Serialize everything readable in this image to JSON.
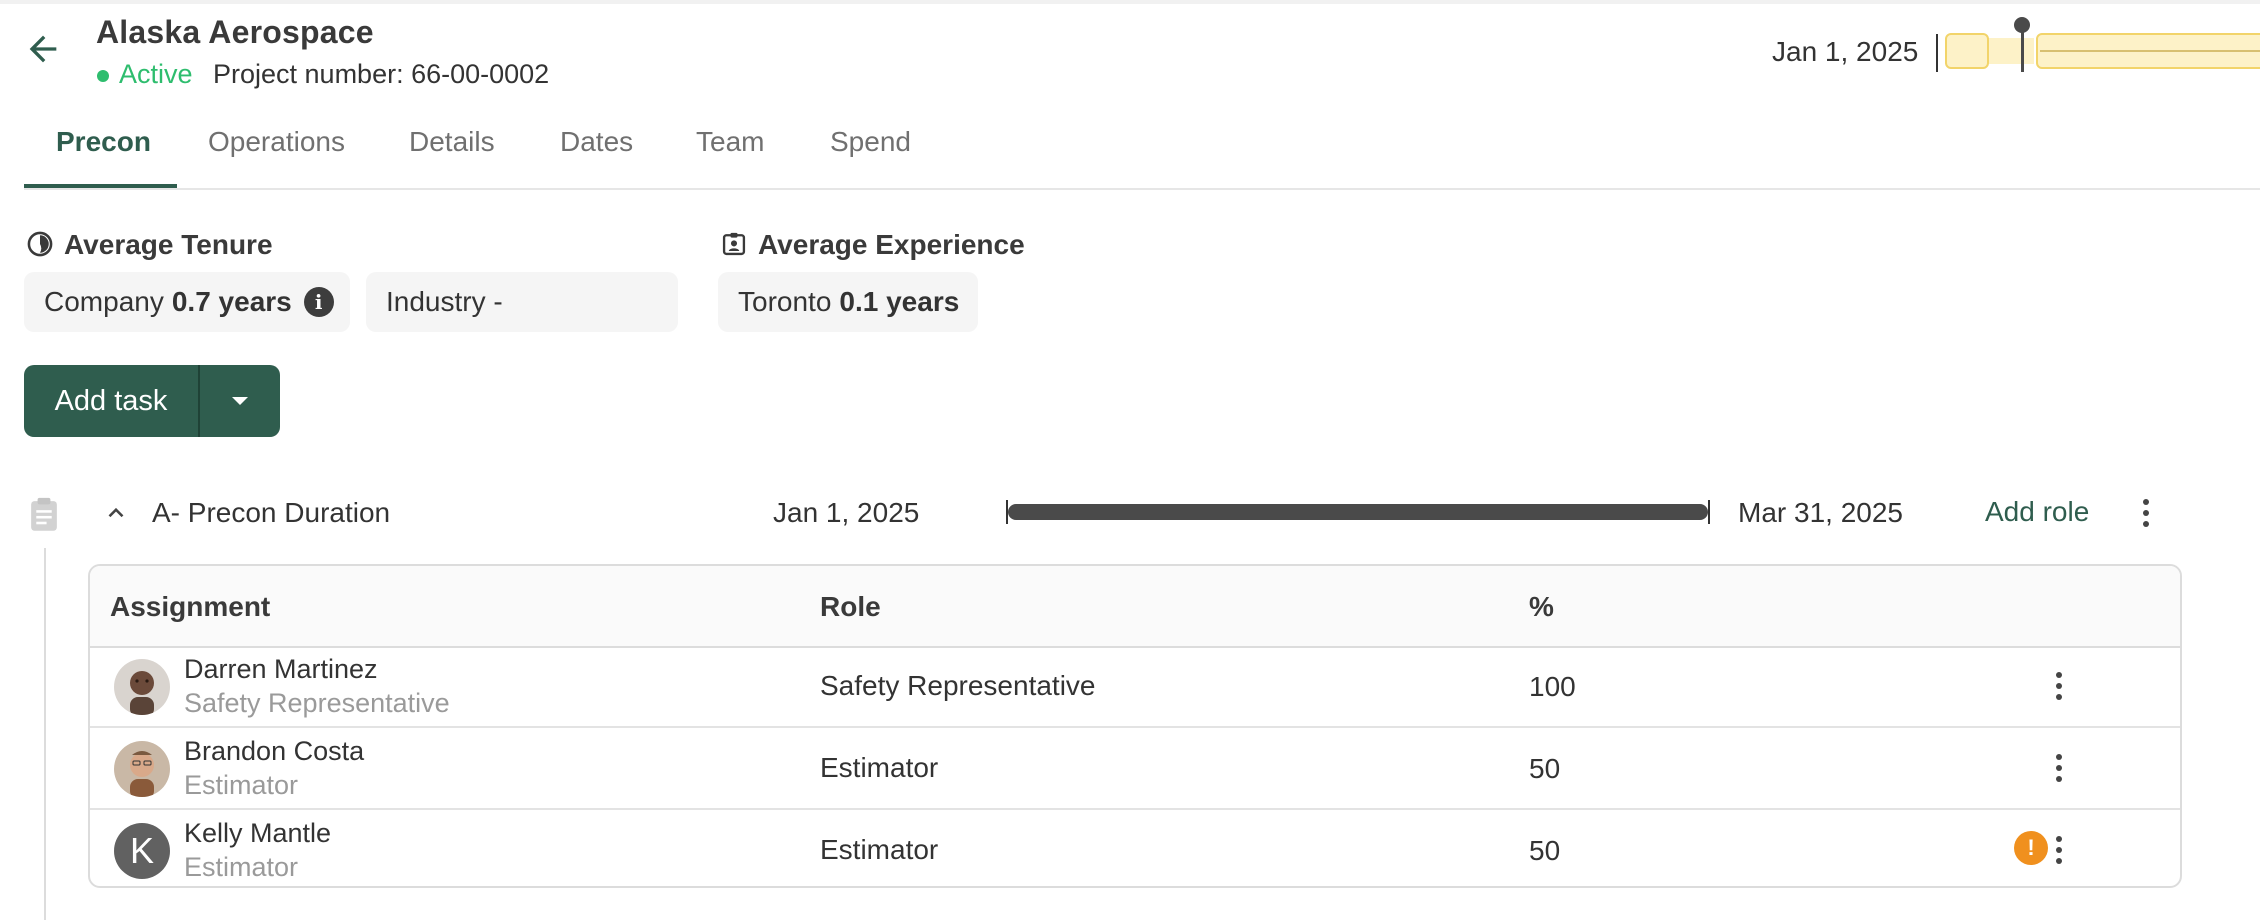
{
  "header": {
    "title": "Alaska Aerospace",
    "status": "Active",
    "project_number": "Project number: 66-00-0002",
    "timeline_date": "Jan 1, 2025"
  },
  "tabs": [
    {
      "label": "Precon",
      "active": true
    },
    {
      "label": "Operations",
      "active": false
    },
    {
      "label": "Details",
      "active": false
    },
    {
      "label": "Dates",
      "active": false
    },
    {
      "label": "Team",
      "active": false
    },
    {
      "label": "Spend",
      "active": false
    }
  ],
  "stats": {
    "tenure": {
      "label": "Average Tenure",
      "company_label": "Company",
      "company_value": "0.7 years",
      "industry_label": "Industry -"
    },
    "experience": {
      "label": "Average Experience",
      "location_label": "Toronto",
      "location_value": "0.1 years"
    }
  },
  "actions": {
    "add_task": "Add task"
  },
  "task": {
    "name": "A- Precon Duration",
    "start": "Jan 1, 2025",
    "end": "Mar 31, 2025",
    "add_role": "Add role"
  },
  "table": {
    "headers": [
      "Assignment",
      "Role",
      "%"
    ],
    "rows": [
      {
        "name": "Darren Martinez",
        "subtitle": "Safety Representative",
        "role": "Safety Representative",
        "percent": "100",
        "warning": false
      },
      {
        "name": "Brandon Costa",
        "subtitle": "Estimator",
        "role": "Estimator",
        "percent": "50",
        "warning": false
      },
      {
        "name": "Kelly Mantle",
        "subtitle": "Estimator",
        "role": "Estimator",
        "percent": "50",
        "warning": true,
        "initial": "K"
      }
    ]
  },
  "colors": {
    "brand": "#2f5d4e",
    "active_status": "#2ebd6e",
    "warning": "#f0901e",
    "timeline_fill": "#fdf2c8"
  },
  "icons": [
    "arrow-left-icon",
    "pie-chart-icon",
    "badge-icon",
    "info-icon",
    "caret-down-icon",
    "clipboard-icon",
    "chevron-up-icon",
    "more-vert-icon",
    "warning-icon"
  ]
}
